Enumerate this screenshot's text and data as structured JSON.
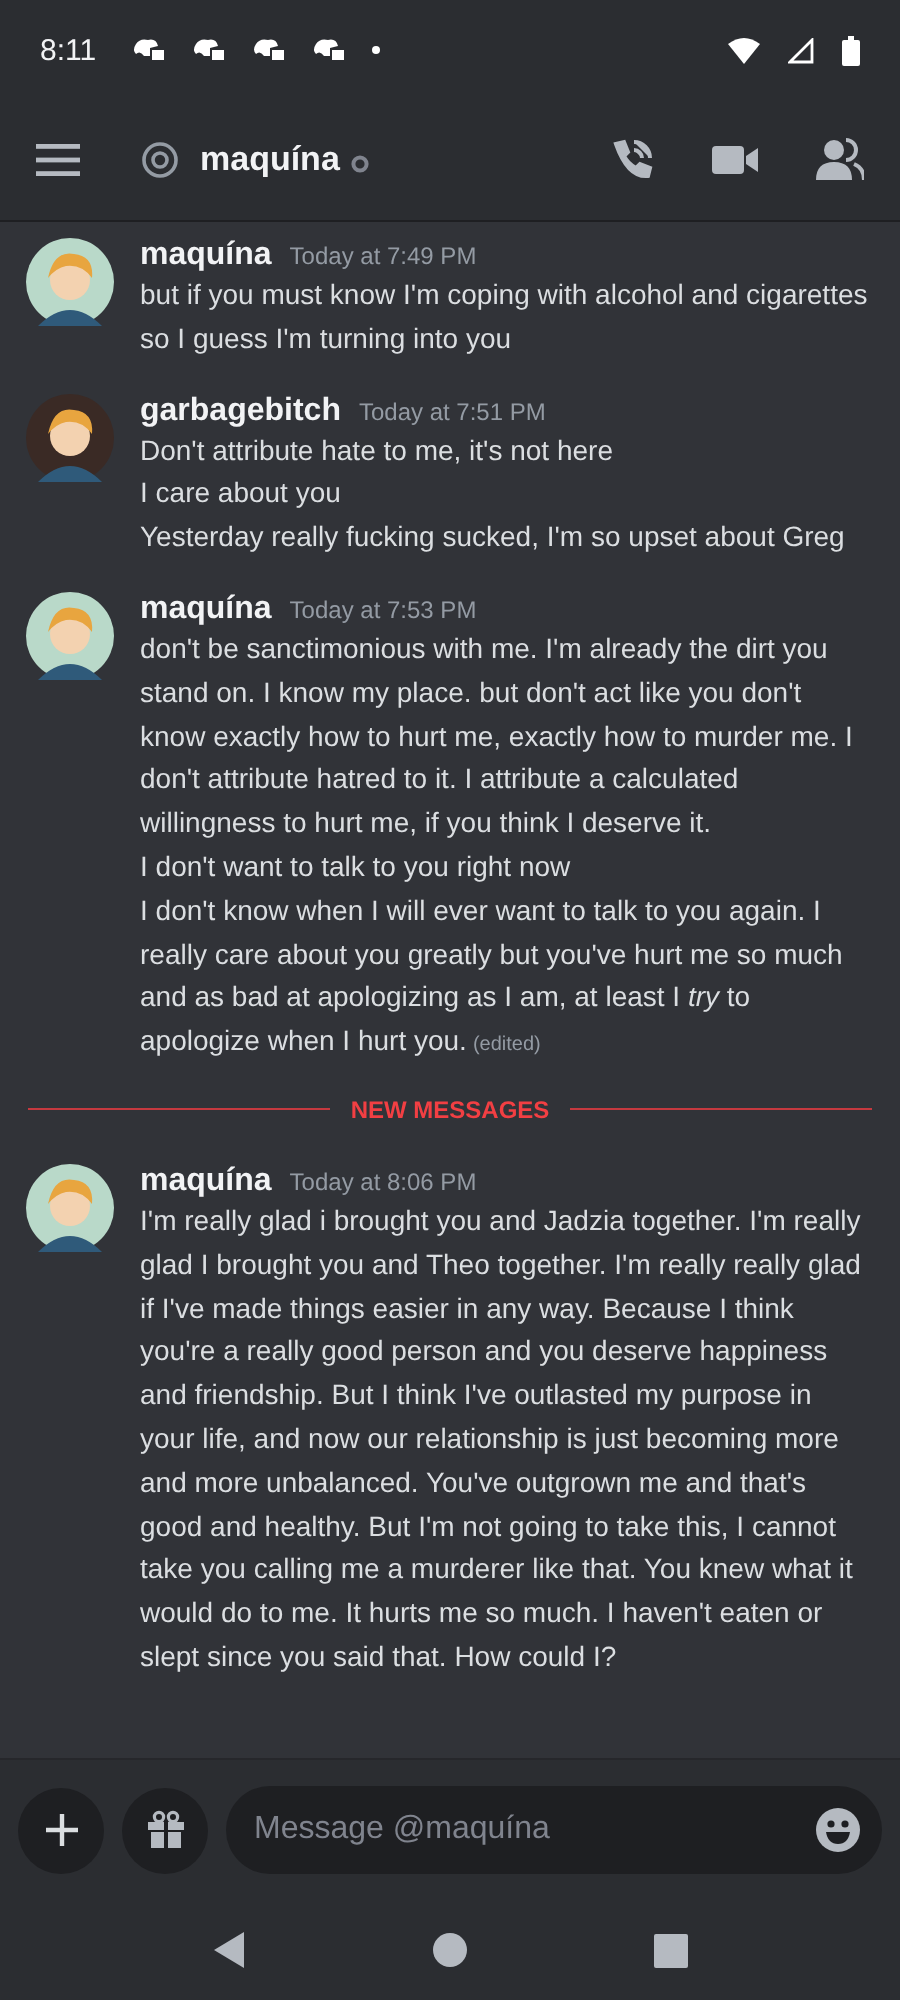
{
  "status_bar": {
    "time": "8:11"
  },
  "header": {
    "channel_name": "maquína"
  },
  "groups": [
    {
      "kind": "message",
      "author": "maquína",
      "color": "#b9d9c9",
      "timestamp": "Today at 7:49 PM",
      "lines": [
        {
          "text": "but if you must know I'm coping with alcohol and cigarettes so I guess I'm turning into you"
        }
      ]
    },
    {
      "kind": "message",
      "author": "garbagebitch",
      "color": "#3a2a25",
      "timestamp": "Today at 7:51 PM",
      "lines": [
        {
          "text": "Don't attribute hate to me, it's not here"
        },
        {
          "text": "I care about you"
        },
        {
          "text": "Yesterday really fucking sucked, I'm so upset about Greg"
        }
      ]
    },
    {
      "kind": "message",
      "author": "maquína",
      "color": "#b9d9c9",
      "timestamp": "Today at 7:53 PM",
      "lines": [
        {
          "text": "don't be sanctimonious with me. I'm already the dirt you stand on. I know my place. but don't act like you don't know exactly how to hurt me, exactly how to murder me. I don't attribute hatred to it. I attribute a calculated willingness to hurt me, if you think I deserve it."
        },
        {
          "text": "I don't want to talk to you right now"
        },
        {
          "text": "I don't know when I will ever want to talk to you again. I really care about you greatly but you've hurt me so much and as bad at apologizing as I am, at least I *try* to apologize when I hurt you.",
          "edited": "(edited)"
        }
      ]
    },
    {
      "kind": "divider",
      "label": "NEW MESSAGES"
    },
    {
      "kind": "message",
      "author": "maquína",
      "color": "#b9d9c9",
      "timestamp": "Today at 8:06 PM",
      "lines": [
        {
          "text": "I'm really glad i brought you and Jadzia together. I'm really glad I brought you and Theo together. I'm really really glad if I've made things easier in any way. Because I think you're a really good person and you deserve happiness and friendship. But I think I've outlasted my purpose in your life, and now our relationship is just becoming more and more unbalanced. You've outgrown me and that's good and healthy. But I'm not going to take this, I cannot take you calling me a murderer like that. You knew what it would do to me. It hurts me so much. I haven't eaten or slept since you said that. How could I?"
        }
      ]
    }
  ],
  "composer": {
    "placeholder": "Message @maquína"
  }
}
